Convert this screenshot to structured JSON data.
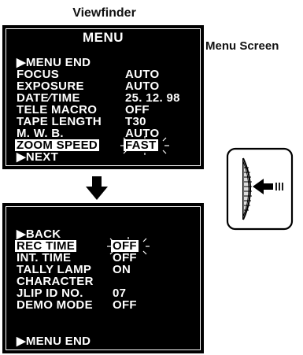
{
  "captions": {
    "viewfinder": "Viewfinder",
    "menu_screen": "Menu Screen"
  },
  "screen1": {
    "title": "MENU",
    "rows": [
      {
        "label": "▶MENU END",
        "value": ""
      },
      {
        "label": "FOCUS",
        "value": "AUTO"
      },
      {
        "label": "EXPOSURE",
        "value": "AUTO"
      },
      {
        "label": "DATE∕TIME",
        "value": "25. 12. 98"
      },
      {
        "label": "TELE  MACRO",
        "value": "OFF"
      },
      {
        "label": "TAPE  LENGTH",
        "value": "T30"
      },
      {
        "label": "M. W. B.",
        "value": "AUTO"
      },
      {
        "label": "ZOOM SPEED",
        "value": "FAST",
        "selected": true
      },
      {
        "label": "▶NEXT",
        "value": ""
      }
    ]
  },
  "screen2": {
    "rows": [
      {
        "label": "▶BACK",
        "value": ""
      },
      {
        "label": "REC TIME",
        "value": "OFF",
        "selected": true
      },
      {
        "label": "INT. TIME",
        "value": "OFF"
      },
      {
        "label": "TALLY LAMP",
        "value": "ON"
      },
      {
        "label": "CHARACTER",
        "value": ""
      },
      {
        "label": "JLIP ID NO.",
        "value": "07"
      },
      {
        "label": "DEMO MODE",
        "value": "OFF"
      },
      {
        "label": "",
        "value": ""
      },
      {
        "label": "▶MENU END",
        "value": ""
      }
    ]
  },
  "icons": {
    "arrow": "arrow-down-icon",
    "dial": "menu-dial-press-icon"
  }
}
